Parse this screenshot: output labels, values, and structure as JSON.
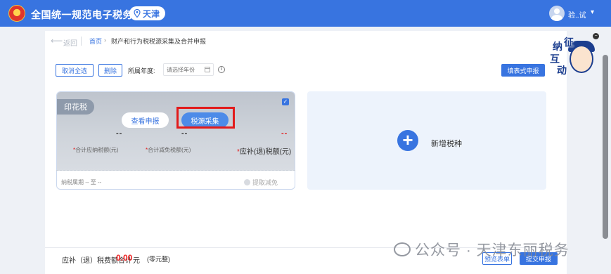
{
  "header": {
    "app_title": "全国统一规范电子税务局",
    "location": "天津",
    "username": "验..试",
    "brand_color": "#3874e0"
  },
  "breadcrumb": {
    "back_label": "返回",
    "home": "首页",
    "current": "财产和行为税税源采集及合并申报"
  },
  "toolbar": {
    "cancel_all": "取消全选",
    "delete": "删除",
    "year_label": "所属年度:",
    "year_placeholder": "请选择年份",
    "fill_form": "填表式申报"
  },
  "tax_card": {
    "tag": "印花税",
    "view_button": "查看申报",
    "collect_button": "税源采集",
    "stats": [
      {
        "value": "--",
        "label": "合计应纳税额(元)"
      },
      {
        "value": "--",
        "label": "合计减免税额(元)"
      },
      {
        "value": "--",
        "label": "应补(退)税额(元)"
      }
    ],
    "period": "纳税属期 -- 至 --",
    "relief_link": "提取减免",
    "accent_red": "#e21b1b"
  },
  "add_card": {
    "label": "新增税种"
  },
  "footer": {
    "total_label": "应补（退）税费额合计",
    "total_value": "0.00",
    "total_unit": "元",
    "total_words": "(零元整)",
    "preview_button": "预览表单",
    "submit_button": "提交申报"
  },
  "mascot": {
    "chars": [
      "征",
      "纳",
      "互",
      "动"
    ]
  },
  "watermark": {
    "text": "公众号 · 天津东丽税务"
  }
}
